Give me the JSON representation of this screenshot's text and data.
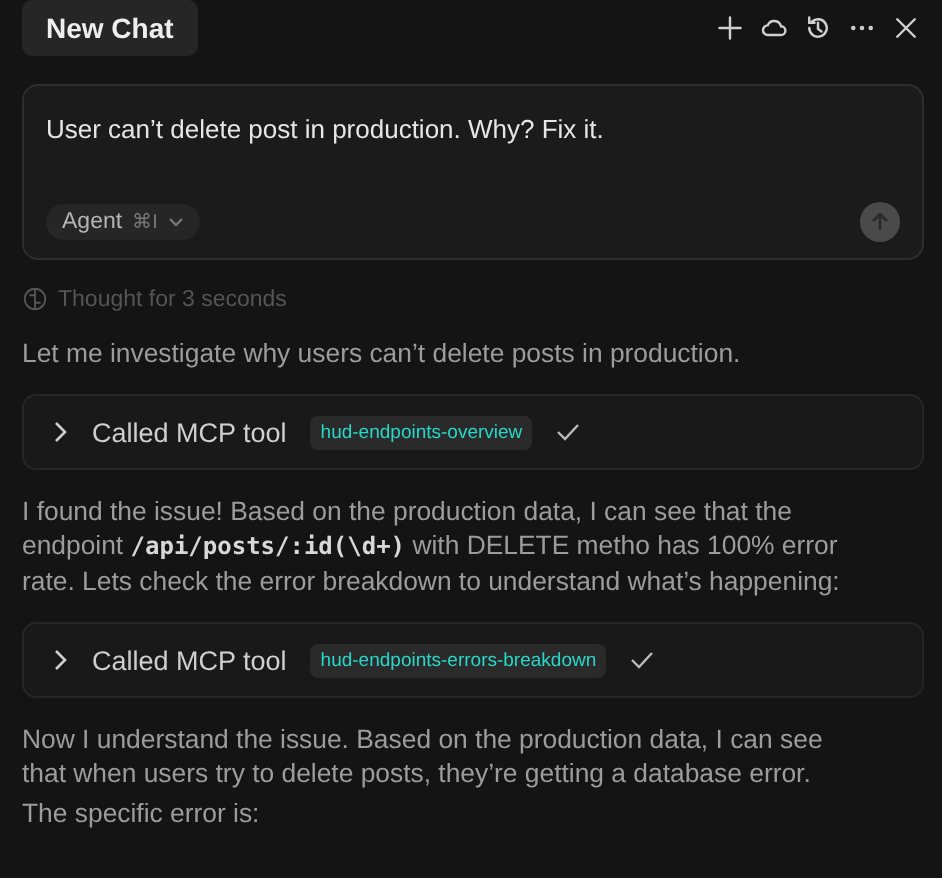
{
  "header": {
    "tab": {
      "label": "New Chat",
      "selected": true
    }
  },
  "composer": {
    "value": "User can’t delete post in production. Why? Fix it.",
    "mode": {
      "label": "Agent",
      "shortcut": "⌘I"
    }
  },
  "thought": "Thought for 3 seconds",
  "messages": [
    {
      "kind": "text",
      "text": "Let me investigate why users can’t delete posts in production."
    },
    {
      "kind": "tool",
      "label": "Called MCP tool",
      "tool": "hud-endpoints-overview",
      "done": true
    },
    {
      "kind": "text",
      "text": "I found the issue! Based on the production data, I can see that the endpoint **/api/posts/:id(\\d+)** with DELETE metho has 100% error rate. Lets check the error breakdown to understand what’s happening:"
    },
    {
      "kind": "tool",
      "label": "Called MCP tool",
      "tool": "hud-endpoints-errors-breakdown",
      "done": true
    },
    {
      "kind": "text",
      "text": "Now I understand the issue. Based on the production data, I can see that when users try to delete posts, they’re getting a database error."
    },
    {
      "kind": "text",
      "text": "The specific error is:"
    }
  ]
}
